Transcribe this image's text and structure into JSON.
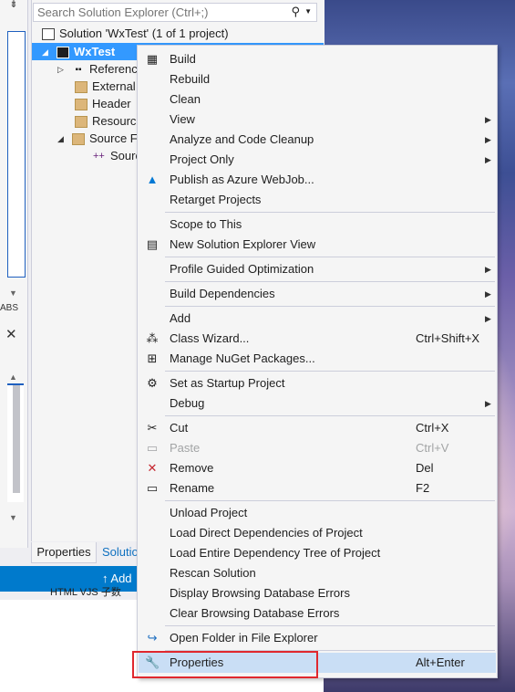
{
  "search": {
    "placeholder": "Search Solution Explorer (Ctrl+;)"
  },
  "tree": {
    "solution": "Solution 'WxTest' (1 of 1 project)",
    "project": "WxTest",
    "references": "Referenc",
    "external": "External",
    "header": "Header",
    "resource": "Resourc",
    "source": "Source F",
    "source_file": "Sourc"
  },
  "left_strip": {
    "abs_label": "ABS",
    "close": "✕",
    "pin": "⇟"
  },
  "tabs": {
    "properties": "Properties",
    "solution": "Solutio"
  },
  "status": {
    "add": "↑ Add"
  },
  "under_text": "HTML  VJS 子数",
  "menu": {
    "items": [
      {
        "label": "Build",
        "icon": "build-icon",
        "shortcut": "",
        "submenu": false
      },
      {
        "label": "Rebuild",
        "shortcut": "",
        "submenu": false
      },
      {
        "label": "Clean",
        "shortcut": "",
        "submenu": false
      },
      {
        "label": "View",
        "shortcut": "",
        "submenu": true
      },
      {
        "label": "Analyze and Code Cleanup",
        "shortcut": "",
        "submenu": true
      },
      {
        "label": "Project Only",
        "shortcut": "",
        "submenu": true
      },
      {
        "label": "Publish as Azure WebJob...",
        "icon": "azure-icon",
        "shortcut": "",
        "submenu": false
      },
      {
        "label": "Retarget Projects",
        "shortcut": "",
        "submenu": false
      },
      {
        "label": "Scope to This",
        "shortcut": "",
        "submenu": false
      },
      {
        "label": "New Solution Explorer View",
        "icon": "new-view-icon",
        "shortcut": "",
        "submenu": false
      },
      {
        "label": "Profile Guided Optimization",
        "shortcut": "",
        "submenu": true
      },
      {
        "label": "Build Dependencies",
        "shortcut": "",
        "submenu": true
      },
      {
        "label": "Add",
        "shortcut": "",
        "submenu": true
      },
      {
        "label": "Class Wizard...",
        "icon": "class-wizard-icon",
        "shortcut": "Ctrl+Shift+X",
        "submenu": false
      },
      {
        "label": "Manage NuGet Packages...",
        "icon": "nuget-icon",
        "shortcut": "",
        "submenu": false
      },
      {
        "label": "Set as Startup Project",
        "icon": "gear-icon",
        "shortcut": "",
        "submenu": false
      },
      {
        "label": "Debug",
        "shortcut": "",
        "submenu": true
      },
      {
        "label": "Cut",
        "icon": "scissors-icon",
        "shortcut": "Ctrl+X",
        "submenu": false
      },
      {
        "label": "Paste",
        "icon": "paste-icon",
        "shortcut": "Ctrl+V",
        "submenu": false,
        "disabled": true
      },
      {
        "label": "Remove",
        "icon": "remove-icon",
        "shortcut": "Del",
        "submenu": false
      },
      {
        "label": "Rename",
        "icon": "rename-icon",
        "shortcut": "F2",
        "submenu": false
      },
      {
        "label": "Unload Project",
        "shortcut": "",
        "submenu": false
      },
      {
        "label": "Load Direct Dependencies of Project",
        "shortcut": "",
        "submenu": false
      },
      {
        "label": "Load Entire Dependency Tree of Project",
        "shortcut": "",
        "submenu": false
      },
      {
        "label": "Rescan Solution",
        "shortcut": "",
        "submenu": false
      },
      {
        "label": "Display Browsing Database Errors",
        "shortcut": "",
        "submenu": false
      },
      {
        "label": "Clear Browsing Database Errors",
        "shortcut": "",
        "submenu": false
      },
      {
        "label": "Open Folder in File Explorer",
        "icon": "open-folder-icon",
        "shortcut": "",
        "submenu": false
      },
      {
        "label": "Properties",
        "icon": "wrench-icon",
        "shortcut": "Alt+Enter",
        "submenu": false,
        "highlighted": true
      }
    ]
  },
  "colors": {
    "accent": "#3399ff",
    "status_bar": "#007acc",
    "highlight_border": "#e0282e",
    "hover": "#c9def5"
  }
}
